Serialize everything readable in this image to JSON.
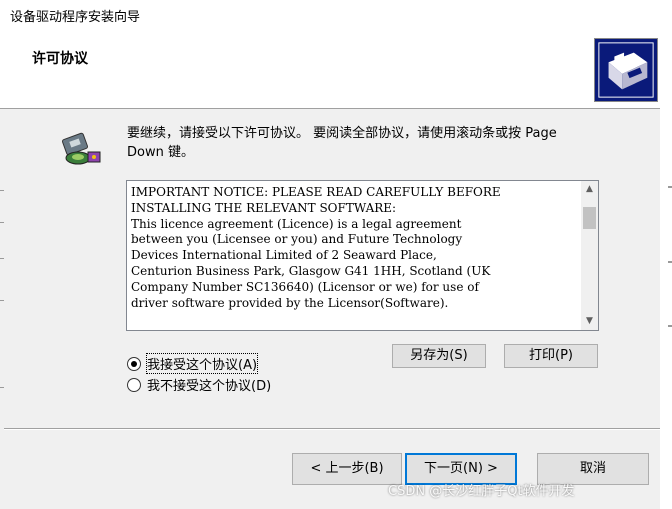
{
  "window": {
    "title": "设备驱动程序安装向导"
  },
  "header": {
    "title": "许可协议",
    "logo_icon": "hardware-install-icon"
  },
  "instruction": {
    "text": "要继续，请接受以下许可协议。 要阅读全部协议，请使用滚动条或按 Page Down 键。"
  },
  "licence": {
    "text": "IMPORTANT NOTICE: PLEASE READ CAREFULLY BEFORE\nINSTALLING THE RELEVANT SOFTWARE:\nThis licence agreement (Licence) is a legal agreement\nbetween you (Licensee or you) and Future Technology\nDevices International Limited of 2 Seaward Place,\nCenturion Business Park, Glasgow G41 1HH, Scotland (UK\nCompany Number SC136640) (Licensor or we) for use of\ndriver software provided by the Licensor(Software)."
  },
  "options": {
    "accept": {
      "label": "我接受这个协议(A)",
      "selected": true
    },
    "decline": {
      "label": "我不接受这个协议(D)",
      "selected": false
    }
  },
  "buttons": {
    "save_as": "另存为(S)",
    "print": "打印(P)",
    "back": "< 上一步(B)",
    "next": "下一页(N) >",
    "cancel": "取消"
  },
  "watermark": {
    "text": "CSDN @长沙红胖子Qt软件开发"
  },
  "colors": {
    "focus_border": "#0078d7",
    "header_bg": "#ffffff",
    "body_bg": "#f0f0f0"
  }
}
